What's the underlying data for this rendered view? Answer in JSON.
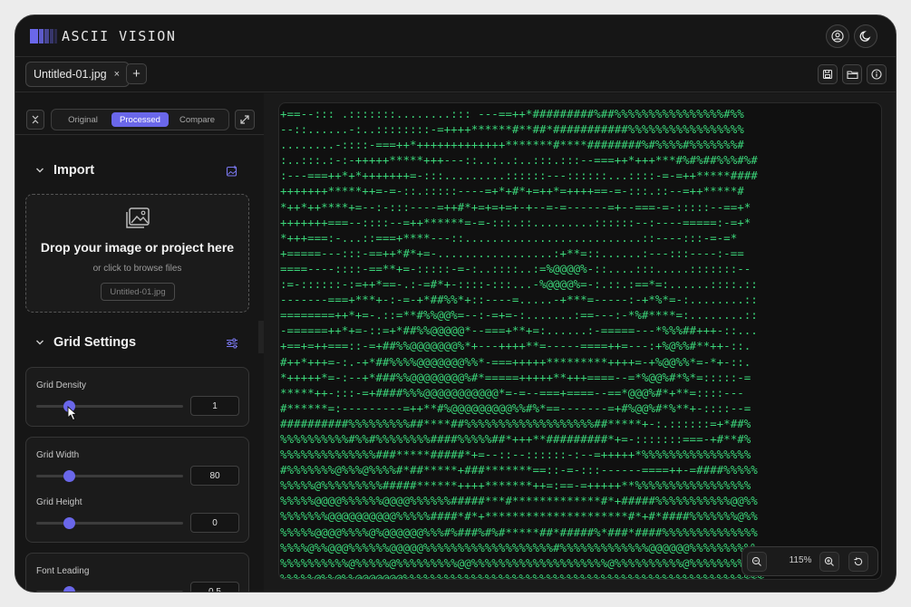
{
  "app": {
    "title": "ASCII VISION"
  },
  "tabs": [
    {
      "label": "Untitled-01.jpg",
      "close": "×"
    }
  ],
  "add_tab_label": "+",
  "view_modes": [
    "Original",
    "Processed",
    "Compare"
  ],
  "active_view_mode": "Processed",
  "import": {
    "title": "Import",
    "drop_title": "Drop your image or project here",
    "drop_sub": "or click to browse files",
    "file_chip": "Untitled-01.jpg"
  },
  "grid_settings": {
    "title": "Grid Settings",
    "density": {
      "label": "Grid Density",
      "value": "1"
    },
    "width": {
      "label": "Grid Width",
      "value": "80"
    },
    "height": {
      "label": "Grid Height",
      "value": "0"
    },
    "leading": {
      "label": "Font Leading",
      "value": "0,5"
    }
  },
  "zoom": {
    "level": "115%"
  },
  "colors": {
    "accent": "#6a67ea",
    "ascii_text": "#3bd67a",
    "background": "#161616"
  },
  "icons": [
    "user-circle-icon",
    "moon-icon",
    "save-icon",
    "folder-icon",
    "info-icon",
    "collapse-icon",
    "expand-icon",
    "image-add-icon",
    "images-icon",
    "sliders-icon",
    "chevron-down-icon",
    "chevron-left-icon",
    "zoom-out-icon",
    "zoom-in-icon",
    "reset-icon"
  ],
  "ascii_lines": [
    "+==--::: .:::::::........::: ---==++*#########%##%%%%%%%%%%%%%%%%#%%",
    "--::......-:..::::::::-=++++******#**##*###########%%%%%%%%%%%%%%%%%",
    "........-::::-===++*+++++++++++++*******#****########%#%%%%#%%%%%%%#",
    ":..:::.:-:-+++++*****+++---::..:..:..:::.:::--===++*+++***#%#%##%%%#%#",
    ":---===++*+*+++++++=-:::.........::::::---::::::...::::-=-=++*****####",
    "+++++++*****++=-=-::.:::::----=+*+#*+=++*=++++==-=-:::.::--=++*****#",
    "*++*++****+=--:-:::----=++#*+=+=+=+-+--=-=------=+--===-=-:::::--==+*",
    "+++++++===--::::--=++******=-=-:::.::.........::::::--:----=====:-=+*",
    "*+++===:-...::===+****---::..........................::----:::-=-=*",
    "+=====---:::-==++*#*+=-.................:+**=::......:---:::----:-==",
    "====----::::-==**+=-:::::-=-:..::::..:=%@@@@%-::....:::.....:::::::--",
    ":=-::::::-:=++*==-.:-=#*+-::::-:::...-%@@@@%=-:.::.:==*=:......::::.::",
    "-------===+***+-:-=-+*##%%*+::----=.....-+***=-----:-+*%*=-:........::",
    "========++*+=-.::=**#%%@@%=--:-=+=-:.......:==---:-*%#****=:........::",
    "-======++*+=-::=+*##%%@@@@@*--===+**+=:......:-=====---*%%%##+++-::...",
    "+==+=++===::-=+##%%@@@@@@@%*+---++++**=-----====++=---:+%@%%#**++-::.",
    "#++*+++=-:.-+*##%%%%@@@@@@@%%*-===+++++*********++++=-+%@@%%*=-*+-::.",
    "*+++++*=-:--+*###%%@@@@@@@@%#*=====+++++**+++====--=*%@@%#*%*=:::::-=",
    "*****++-:::-=+####%%%@@@@@@@@@@@*=-=--===+====--==*@@@%#*+**=::::---",
    "#******=:---------=++**#%@@@@@@@@@%%#%*==-------=+#%@@%#*%**+-::::--=",
    "##########%%%%%%%%%##****##%%%%%%%%%%%%%%%%%%%##*****+-:.::::::=+*##%",
    "%%%%%%%%%%#%%#%%%%%%%%####%%%%%##*+++**#########*+=-:::::::===-+#**#%",
    "%%%%%%%%%%%%%%###*****#####*+=--::--::::::-:--=+++++*%%%%%%%%%%%%%%%%",
    "#%%%%%%%@%%%@%%%%#*##*****+###*******==::-=-:::------====++-=####%%%%%",
    "%%%%%@%%%%%%%%%#####******++++*******++=:==-=+++++**%%%%%%%%%%%%%%%%%",
    "%%%%%@@@@%%%%%%@@@@%%%%%%#####***#*************#*+#####%%%%%%%%%%%@@%%",
    "%%%%%%%@@@@@@@@@@%%%%%####*#*+*********************#*+#*####%%%%%%%@%%",
    "%%%%%@@@@%%%%@%@@@@@@%%%#%###%#%#*****##*#####%*###*####%%%%%%%%%%%%%%",
    "%%%%@%%@@@%%%%%%@@@@@%%%%%%%%%%%%%%%%%%%#%%%%%%%%%%%%%@@@@@@%%%%%%%%%%",
    "%%%%%%%%%%@%%%%%@%%%%%%%%%@@%%%%%%%%%%%%%%%%%%%%@%%%%%%%%%%@%%%%%%%%%%%",
    "%%%%%@%%@%%@@@@@@@%%%%%%%%%%%%%%%%%%%%%%%%%%%%%%%%%%%%%%%%%%%%%%%%%%%%%"
  ]
}
